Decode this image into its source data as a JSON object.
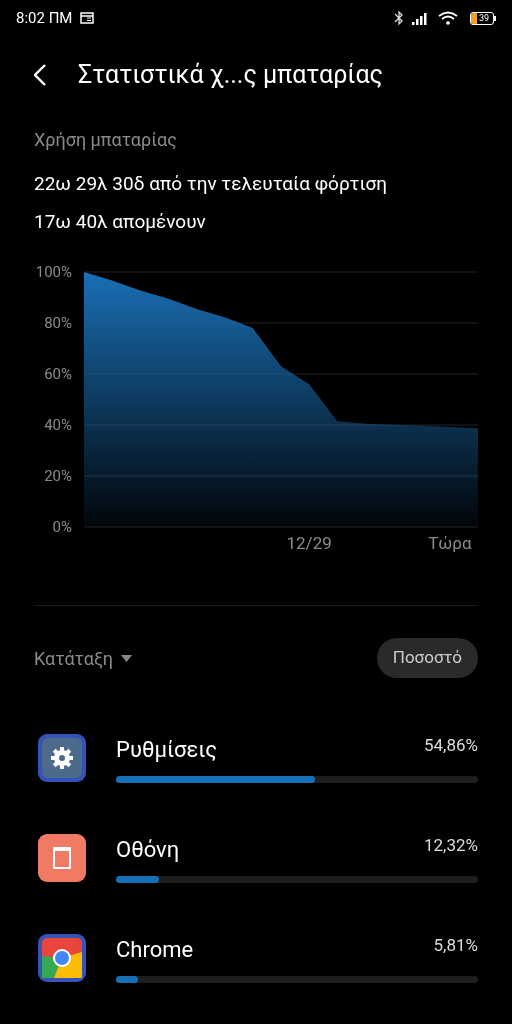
{
  "status_bar": {
    "time": "8:02 ΠΜ",
    "battery": "39"
  },
  "header": {
    "title": "Στατιστικά χ...ς μπαταρίας"
  },
  "usage": {
    "label": "Χρήση μπαταρίας",
    "lines": [
      "22ω 29λ 30δ από την τελευταία φόρτιση",
      "17ω 40λ απομένουν"
    ]
  },
  "chart_data": {
    "type": "area",
    "grid": true,
    "categories": [
      null,
      null,
      null,
      null,
      null,
      null,
      null,
      null,
      "12/29",
      null,
      null,
      null,
      null,
      "Τώρα",
      null
    ],
    "series": [
      {
        "color": "#1a6fb5",
        "values": [
          100,
          96.7,
          92.7,
          89.5,
          85.5,
          82.3,
          78,
          63,
          56,
          41.5,
          40.5,
          40.1,
          39.7,
          39.2,
          38.7
        ]
      }
    ],
    "ylim": [
      0,
      100
    ],
    "yticks": [
      {
        "value": 0,
        "label": "0%"
      },
      {
        "value": 20,
        "label": "20%"
      },
      {
        "value": 40,
        "label": "40%"
      },
      {
        "value": 60,
        "label": "60%"
      },
      {
        "value": 80,
        "label": "80%"
      },
      {
        "value": 100,
        "label": "100%"
      }
    ]
  },
  "sort": {
    "label": "Κατάταξη",
    "button": "Ποσοστό"
  },
  "apps": [
    {
      "kind": "settings",
      "name": "Ρυθμίσεις",
      "percent": "54,86%",
      "level": 0.55
    },
    {
      "kind": "screen",
      "name": "Οθόνη",
      "percent": "12,32%",
      "level": 0.12
    },
    {
      "kind": "browser",
      "name": "Chrome",
      "percent": "5,81%",
      "level": 0.06
    }
  ]
}
